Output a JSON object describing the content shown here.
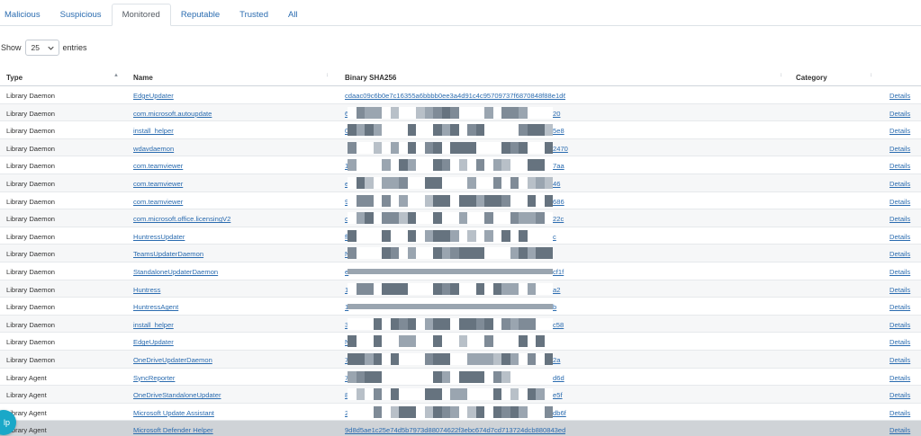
{
  "tabs": [
    "Malicious",
    "Suspicious",
    "Monitored",
    "Reputable",
    "Trusted",
    "All"
  ],
  "active_tab": 2,
  "length": {
    "show_label": "Show",
    "value": "25",
    "entries_label": "entries"
  },
  "columns": {
    "type": "Type",
    "name": "Name",
    "hash": "Binary SHA256",
    "category": "Category"
  },
  "details_label": "Details",
  "help_label": "lp",
  "rows": [
    {
      "type": "Library Daemon",
      "name": "EdgeUpdater",
      "hash_start": "c",
      "hash_visible": "cdaac09c6b0e7c16355a6bbbb0ee3a4d91c4c95709737f6870848f88e1d6310e",
      "hash_end": "",
      "mask": "none"
    },
    {
      "type": "Library Daemon",
      "name": "com.microsoft.autoupdate",
      "hash_start": "6",
      "hash_end": "20",
      "mask": "full"
    },
    {
      "type": "Library Daemon",
      "name": "install_helper",
      "hash_start": "0",
      "hash_end": "5e8",
      "mask": "full"
    },
    {
      "type": "Library Daemon",
      "name": "wdavdaemon",
      "hash_start": "",
      "hash_end": "2470",
      "mask": "full"
    },
    {
      "type": "Library Daemon",
      "name": "com.teamviewer",
      "hash_start": "1",
      "hash_end": "7aa",
      "mask": "full"
    },
    {
      "type": "Library Daemon",
      "name": "com.teamviewer",
      "hash_start": "e",
      "hash_end": "46",
      "mask": "full"
    },
    {
      "type": "Library Daemon",
      "name": "com.teamviewer",
      "hash_start": "9",
      "hash_end": "686",
      "mask": "full"
    },
    {
      "type": "Library Daemon",
      "name": "com.microsoft.office.licensingV2",
      "hash_start": "c",
      "hash_end": "22c",
      "mask": "full"
    },
    {
      "type": "Library Daemon",
      "name": "HuntressUpdater",
      "hash_start": "fl",
      "hash_end": "c",
      "mask": "full"
    },
    {
      "type": "Library Daemon",
      "name": "TeamsUpdaterDaemon",
      "hash_start": "N",
      "hash_end": "",
      "mask": "full"
    },
    {
      "type": "Library Daemon",
      "name": "StandaloneUpdaterDaemon",
      "hash_start": "e",
      "hash_end": "cf1f",
      "mask": "bar"
    },
    {
      "type": "Library Daemon",
      "name": "Huntress",
      "hash_start": "1",
      "hash_end": "a2",
      "mask": "full"
    },
    {
      "type": "Library Daemon",
      "name": "HuntressAgent",
      "hash_start": "1",
      "hash_end": "b",
      "mask": "bar"
    },
    {
      "type": "Library Daemon",
      "name": "install_helper",
      "hash_start": "3",
      "hash_end": "c58",
      "mask": "full"
    },
    {
      "type": "Library Daemon",
      "name": "EdgeUpdater",
      "hash_start": "N",
      "hash_end": "",
      "mask": "full"
    },
    {
      "type": "Library Daemon",
      "name": "OneDriveUpdaterDaemon",
      "hash_start": "7",
      "hash_end": "2a",
      "mask": "full"
    },
    {
      "type": "Library Agent",
      "name": "SyncReporter",
      "hash_start": "7",
      "hash_end": "d6d",
      "mask": "full"
    },
    {
      "type": "Library Agent",
      "name": "OneDriveStandaloneUpdater",
      "hash_start": "8",
      "hash_end": "e5f",
      "mask": "full"
    },
    {
      "type": "Library Agent",
      "name": "Microsoft Update Assistant",
      "hash_start": "2",
      "hash_end": "db6f",
      "mask": "full"
    },
    {
      "type": "Library Agent",
      "name": "Microsoft Defender Helper",
      "hash_start": "",
      "hash_visible": "9d8d5ae1c25e74d5b7973d88074622f3ebc674d7cd713724dcb880843edf63d6",
      "hash_end": "",
      "mask": "none"
    }
  ]
}
